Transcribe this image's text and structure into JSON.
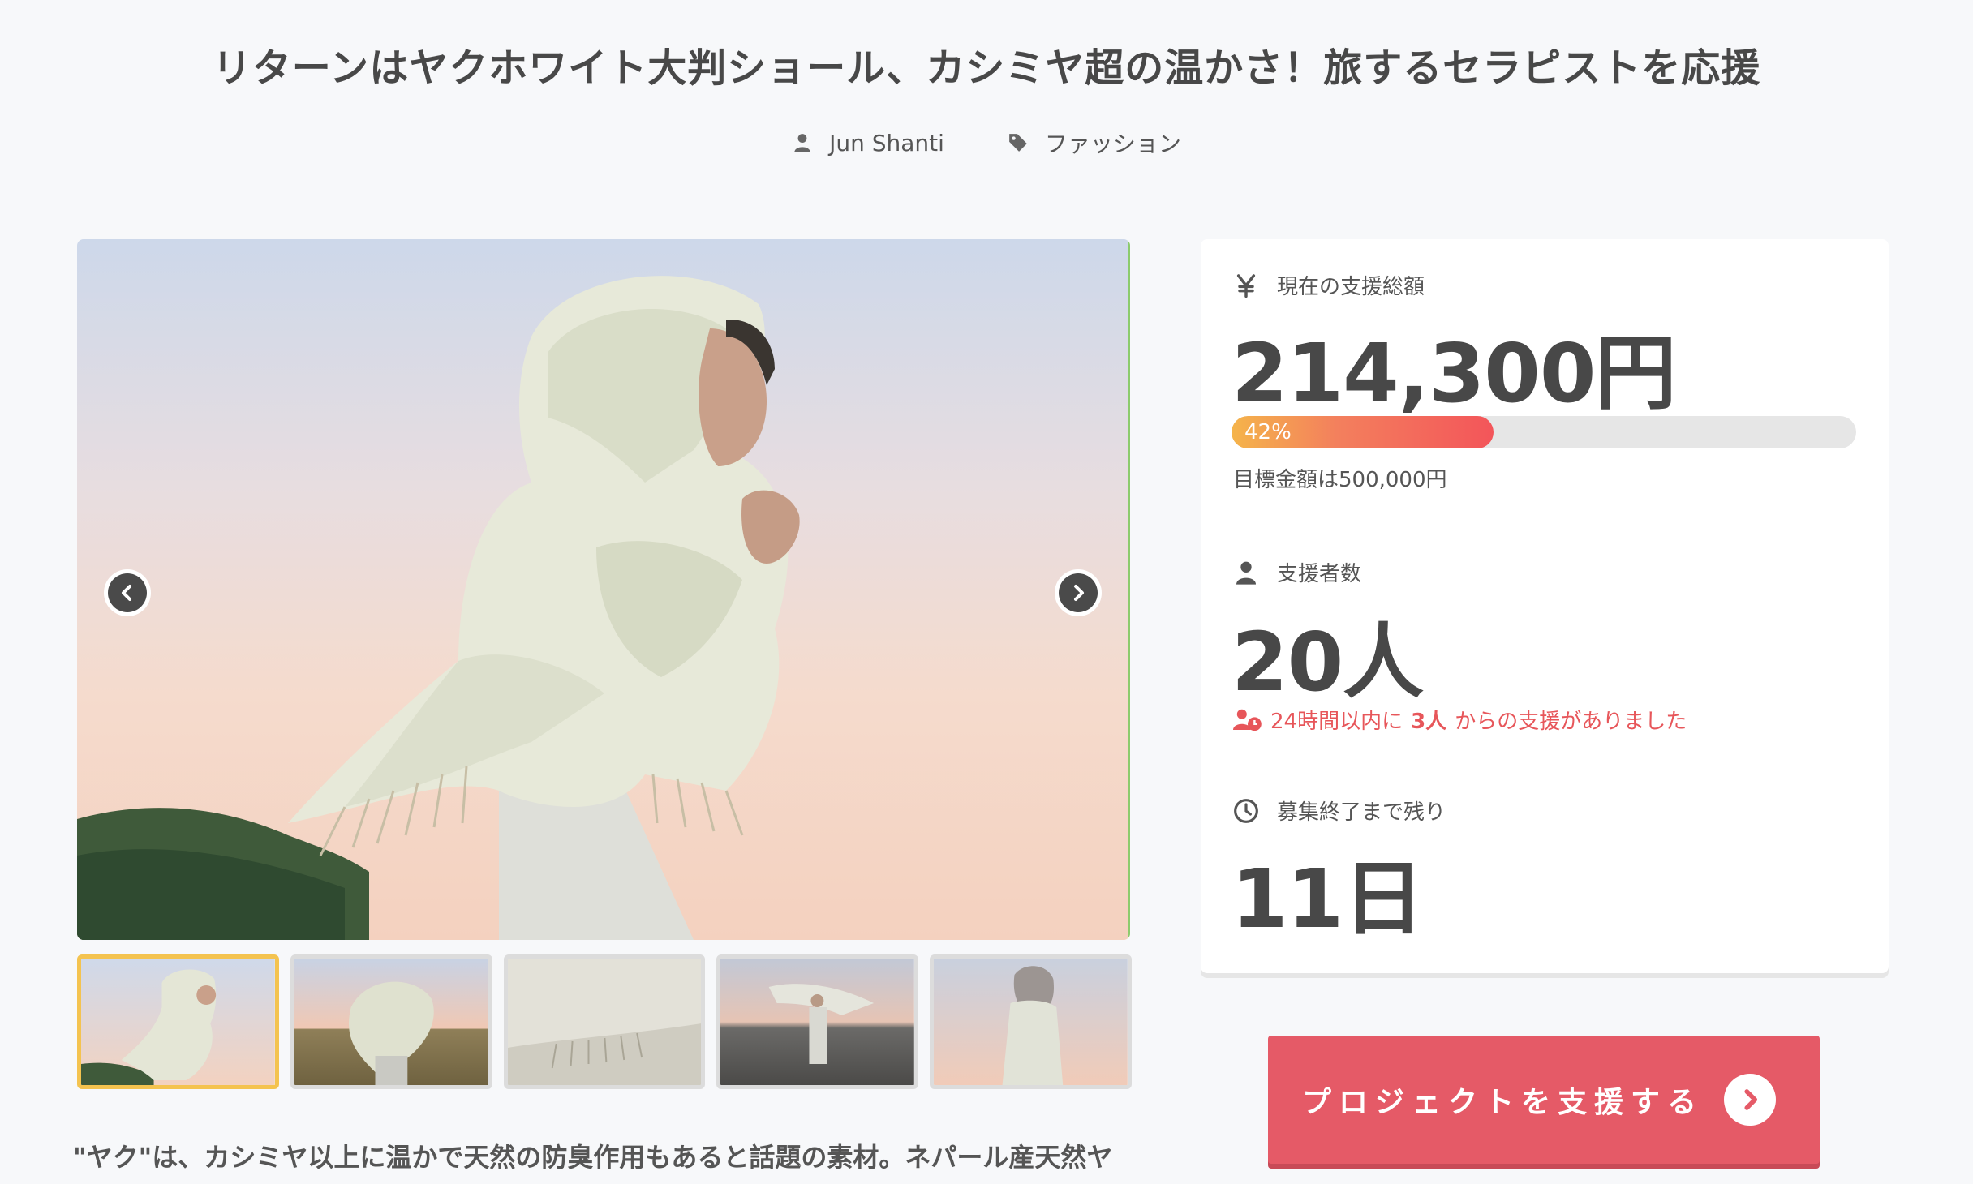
{
  "project": {
    "title": "リターンはヤクホワイト大判ショール、カシミヤ超の温かさ！旅するセラピストを応援",
    "author": "Jun Shanti",
    "category": "ファッション",
    "description": "\"ヤク\"は、カシミヤ以上に温かで天然の防臭作用もあると話題の素材。ネパール産天然ヤ"
  },
  "gallery": {
    "thumbnail_count": 5,
    "active_index": 0
  },
  "stats": {
    "total_label": "現在の支援総額",
    "total_value": "214,300円",
    "progress_percent": 42,
    "progress_label": "42%",
    "target_text": "目標金額は500,000円",
    "supporters_label": "支援者数",
    "supporters_value": "20人",
    "recent_prefix": "24時間以内に",
    "recent_count": "3人",
    "recent_suffix": "からの支援がありました",
    "remaining_label": "募集終了まで残り",
    "remaining_value": "11日"
  },
  "cta": {
    "support_label": "プロジェクトを支援する"
  },
  "icons": {
    "author": "user-icon",
    "category": "tag-icon",
    "total": "yen-icon",
    "supporters": "user-icon",
    "recent": "user-clock-icon",
    "remaining": "clock-icon",
    "cta": "chevron-right-circle-icon"
  },
  "colors": {
    "accent": "#e55a67",
    "progress_start": "#f5b44a",
    "progress_end": "#f3555a",
    "thumb_active": "#f4c34f",
    "recent_text": "#e7565a"
  }
}
